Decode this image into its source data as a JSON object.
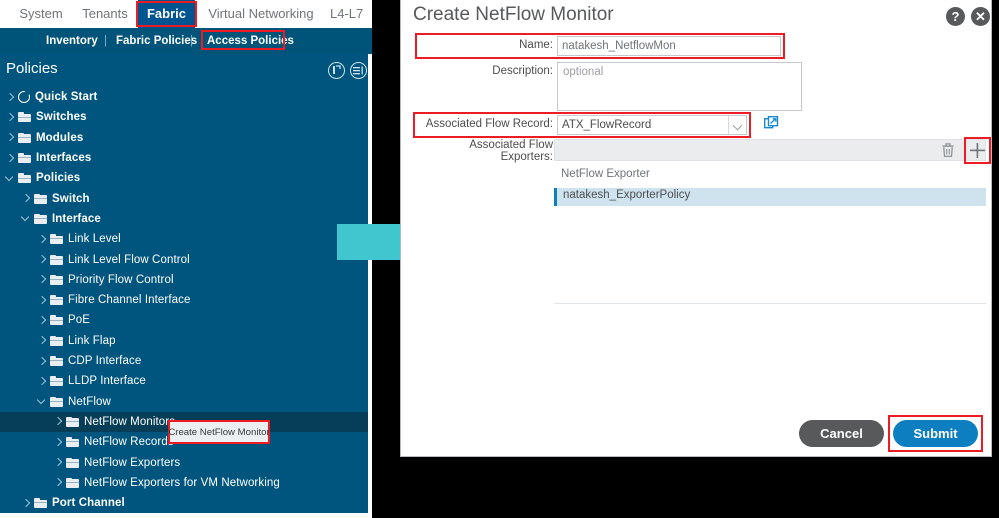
{
  "app": {
    "top_nav": [
      {
        "label": "System",
        "active": false
      },
      {
        "label": "Tenants",
        "active": false
      },
      {
        "label": "Fabric",
        "active": true
      },
      {
        "label": "Virtual Networking",
        "active": false
      },
      {
        "label": "L4-L7",
        "active": false
      }
    ],
    "sub_nav": [
      {
        "label": "Inventory",
        "active": false
      },
      {
        "label": "Fabric Policies",
        "active": false
      },
      {
        "label": "Access Policies",
        "active": true
      }
    ],
    "sub_nav_separator": "|"
  },
  "sidebar": {
    "title": "Policies",
    "header_icons": [
      "collapse-all-icon",
      "navigation-icon"
    ],
    "tree": [
      {
        "label": "Quick Start",
        "indent": 0,
        "icon": "quickstart-icon",
        "expanded": false,
        "selected": false
      },
      {
        "label": "Switches",
        "indent": 0,
        "icon": "folder-icon",
        "expanded": false,
        "selected": false
      },
      {
        "label": "Modules",
        "indent": 0,
        "icon": "folder-icon",
        "expanded": false,
        "selected": false
      },
      {
        "label": "Interfaces",
        "indent": 0,
        "icon": "folder-icon",
        "expanded": false,
        "selected": false
      },
      {
        "label": "Policies",
        "indent": 0,
        "icon": "folder-icon",
        "expanded": true,
        "selected": false
      },
      {
        "label": "Switch",
        "indent": 1,
        "icon": "folder-icon",
        "expanded": false,
        "selected": false
      },
      {
        "label": "Interface",
        "indent": 1,
        "icon": "folder-icon",
        "expanded": true,
        "selected": false
      },
      {
        "label": "Link Level",
        "indent": 2,
        "icon": "folder-icon",
        "expanded": false,
        "selected": false
      },
      {
        "label": "Link Level Flow Control",
        "indent": 2,
        "icon": "folder-icon",
        "expanded": false,
        "selected": false
      },
      {
        "label": "Priority Flow Control",
        "indent": 2,
        "icon": "folder-icon",
        "expanded": false,
        "selected": false
      },
      {
        "label": "Fibre Channel Interface",
        "indent": 2,
        "icon": "folder-icon",
        "expanded": false,
        "selected": false
      },
      {
        "label": "PoE",
        "indent": 2,
        "icon": "folder-icon",
        "expanded": false,
        "selected": false
      },
      {
        "label": "Link Flap",
        "indent": 2,
        "icon": "folder-icon",
        "expanded": false,
        "selected": false
      },
      {
        "label": "CDP Interface",
        "indent": 2,
        "icon": "folder-icon",
        "expanded": false,
        "selected": false
      },
      {
        "label": "LLDP Interface",
        "indent": 2,
        "icon": "folder-icon",
        "expanded": false,
        "selected": false
      },
      {
        "label": "NetFlow",
        "indent": 2,
        "icon": "folder-icon",
        "expanded": true,
        "selected": false
      },
      {
        "label": "NetFlow Monitors",
        "indent": 3,
        "icon": "folder-icon",
        "expanded": false,
        "selected": true
      },
      {
        "label": "NetFlow Records",
        "indent": 3,
        "icon": "folder-icon",
        "expanded": false,
        "selected": false
      },
      {
        "label": "NetFlow Exporters",
        "indent": 3,
        "icon": "folder-icon",
        "expanded": false,
        "selected": false
      },
      {
        "label": "NetFlow Exporters for VM Networking",
        "indent": 3,
        "icon": "folder-icon",
        "expanded": false,
        "selected": false
      },
      {
        "label": "Port Channel",
        "indent": 1,
        "icon": "folder-icon",
        "expanded": false,
        "selected": false
      }
    ]
  },
  "context_menu": {
    "item": "Create NetFlow Monitor"
  },
  "dialog": {
    "title": "Create NetFlow Monitor",
    "help_icon": "help-icon",
    "close_icon": "close-icon",
    "fields": {
      "name_label": "Name:",
      "name_value": "natakesh_NetflowMon",
      "description_label": "Description:",
      "description_placeholder": "optional",
      "description_value": "",
      "flow_record_label": "Associated Flow Record:",
      "flow_record_value": "ATX_FlowRecord",
      "flow_record_link_icon": "open-in-new-icon",
      "exporters_label": "Associated Flow Exporters:",
      "exporters_delete_icon": "trash-icon",
      "exporters_add_icon": "plus-icon",
      "exporters_column_header": "NetFlow Exporter",
      "exporters_rows": [
        "natakesh_ExporterPolicy"
      ]
    },
    "buttons": {
      "cancel": "Cancel",
      "submit": "Submit"
    }
  },
  "annotations": {
    "highlight_color": "#ed1c24",
    "arrow_color": "#3fc6cf",
    "accent_blue": "#0d7fc0",
    "nav_active_bg": "#00548f",
    "sidebar_bg": "#00557e"
  }
}
